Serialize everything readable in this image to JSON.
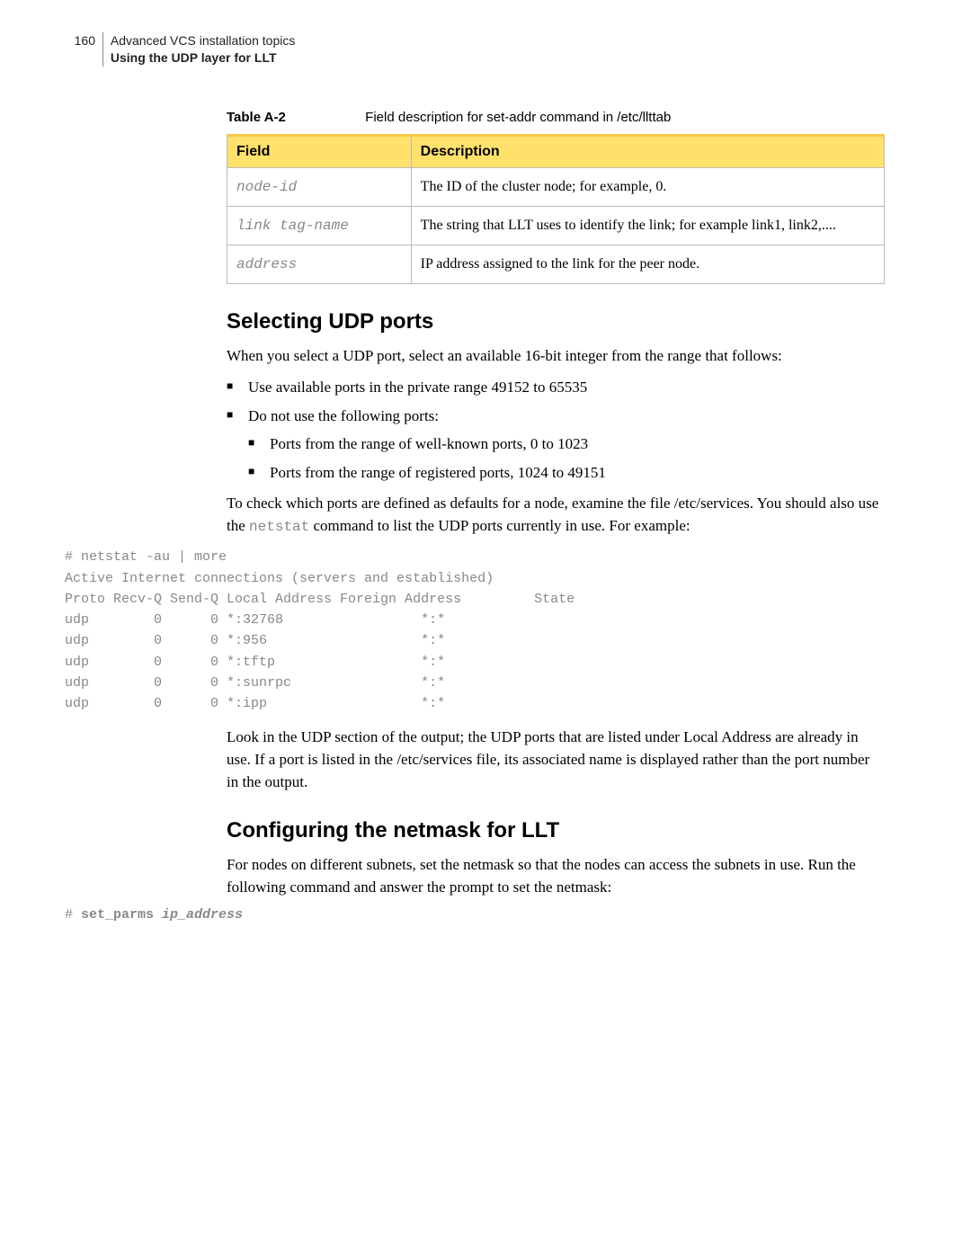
{
  "runhead": {
    "pagenum": "160",
    "line1": "Advanced VCS installation topics",
    "line2": "Using the UDP layer for LLT"
  },
  "table": {
    "number": "Table A-2",
    "caption": "Field description for set-addr command in /etc/llttab",
    "headers": {
      "col1": "Field",
      "col2": "Description"
    },
    "rows": [
      {
        "field": "node-id",
        "desc": "The ID of the cluster node; for example, 0."
      },
      {
        "field": "link tag-name",
        "desc": "The string that LLT uses to identify the link; for example link1, link2,...."
      },
      {
        "field": "address",
        "desc": "IP address assigned to the link for the peer node."
      }
    ]
  },
  "sec1": {
    "heading": "Selecting UDP ports",
    "p1": "When you select a UDP port, select an available 16-bit integer from the range that follows:",
    "b1": "Use available ports in the private range 49152 to 65535",
    "b2": "Do not use the following ports:",
    "b2a": "Ports from the range of well-known ports, 0 to 1023",
    "b2b": "Ports from the range of registered ports, 1024 to 49151",
    "p2a": "To check which ports are defined as defaults for a node, examine the file /etc/services. You should also use the ",
    "p2code": "netstat",
    "p2b": " command to list the UDP ports currently in use. For example:",
    "code": "# netstat -au | more\nActive Internet connections (servers and established)\nProto Recv-Q Send-Q Local Address Foreign Address         State\nudp        0      0 *:32768                 *:*\nudp        0      0 *:956                   *:*\nudp        0      0 *:tftp                  *:*\nudp        0      0 *:sunrpc                *:*\nudp        0      0 *:ipp                   *:*",
    "p3": "Look in the UDP section of the output; the UDP ports that are listed under Local Address are already in use. If a port is listed in the /etc/services file, its associated name is displayed rather than the port number in the output."
  },
  "sec2": {
    "heading": "Configuring the netmask for LLT",
    "p1": "For nodes on different subnets, set the netmask so that the nodes can access the subnets in use. Run the following command and answer the prompt to set the netmask:",
    "cmd_prompt": "# ",
    "cmd_bold": "set_parms ",
    "cmd_arg": "ip_address"
  }
}
